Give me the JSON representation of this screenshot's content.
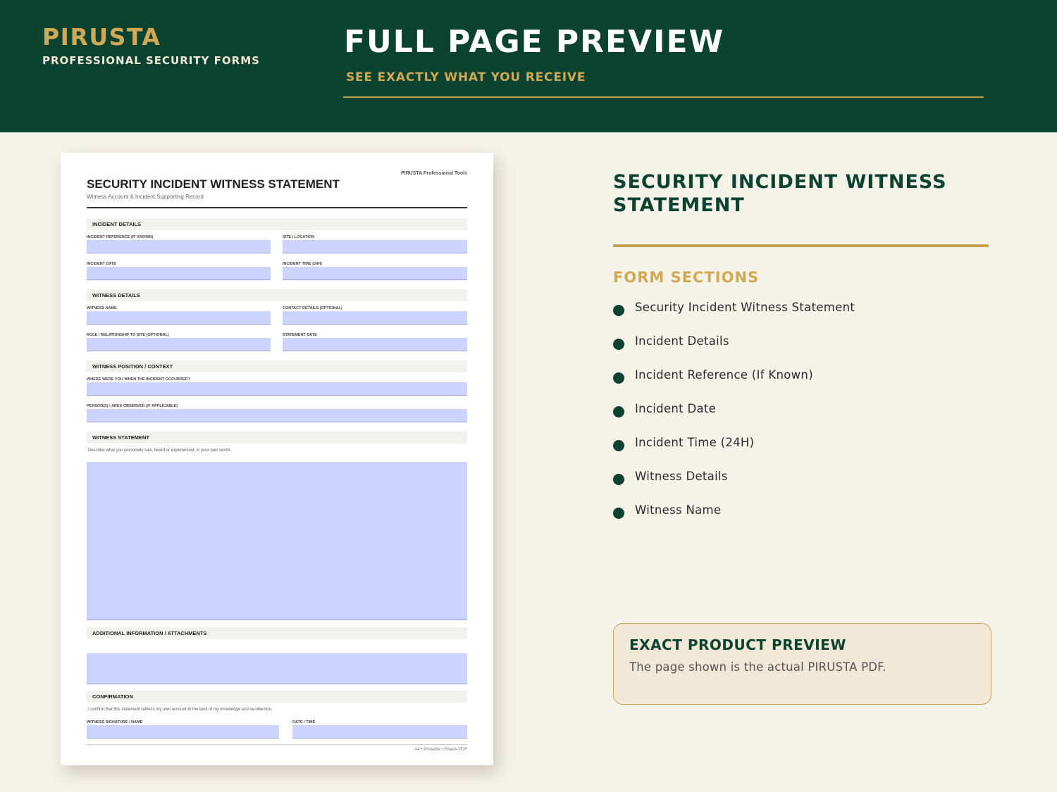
{
  "header": {
    "brand": "PIRUSTA",
    "brand_sub": "PROFESSIONAL SECURITY FORMS",
    "title": "FULL PAGE PREVIEW",
    "subtitle": "SEE EXACTLY WHAT YOU RECEIVE"
  },
  "document": {
    "tools": "PIRUSTA Professional Tools",
    "title": "SECURITY INCIDENT WITNESS STATEMENT",
    "subtitle": "Witness Account & Incident Supporting Record",
    "sections": {
      "incident": "INCIDENT DETAILS",
      "witness": "WITNESS DETAILS",
      "position": "WITNESS POSITION / CONTEXT",
      "statement": "WITNESS STATEMENT",
      "additional": "ADDITIONAL INFORMATION / ATTACHMENTS",
      "confirmation": "CONFIRMATION"
    },
    "fields": {
      "incident_ref": "INCIDENT REFERENCE (IF KNOWN)",
      "site": "SITE / LOCATION",
      "incident_date": "INCIDENT DATE",
      "incident_time": "INCIDENT TIME (24H)",
      "witness_name": "WITNESS NAME",
      "contact": "CONTACT DETAILS (OPTIONAL)",
      "role": "ROLE / RELATIONSHIP TO SITE (OPTIONAL)",
      "statement_date": "STATEMENT DATE",
      "where": "WHERE WERE YOU WHEN THE INCIDENT OCCURRED?",
      "persons": "PERSON(S) / AREA OBSERVED (IF APPLICABLE)",
      "signature": "WITNESS SIGNATURE / NAME",
      "date_time": "DATE / TIME"
    },
    "statement_note": "Describe what you personally saw, heard or experienced, in your own words.",
    "confirmation_note": "I confirm that this statement reflects my own account to the best of my knowledge and recollection.",
    "footer": "A4 • Printable • Fillable PDF"
  },
  "panel": {
    "title": "SECURITY INCIDENT WITNESS STATEMENT",
    "sections_heading": "FORM SECTIONS",
    "sections": [
      "Security Incident Witness Statement",
      "Incident Details",
      "Incident Reference (If Known)",
      "Incident Date",
      "Incident Time (24H)",
      "Witness Details",
      "Witness Name"
    ],
    "callout_title": "EXACT PRODUCT PREVIEW",
    "callout_text": "The page shown is the actual PIRUSTA PDF."
  },
  "colors": {
    "header_bg": "#0b4230",
    "accent_gold": "#d1a955",
    "page_bg": "#f5f2ea",
    "field_fill": "#ccd3fd"
  }
}
